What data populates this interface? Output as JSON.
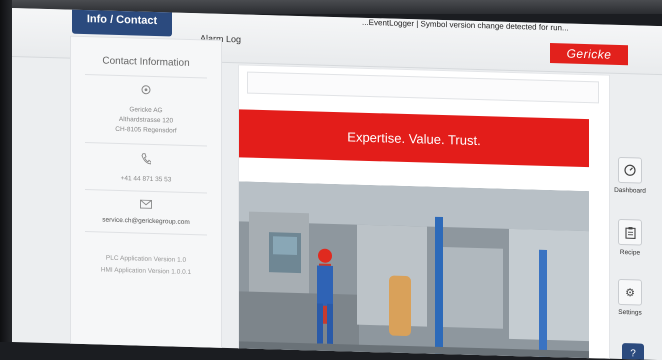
{
  "header": {
    "active_tab_label": "Info / Contact",
    "alarm_tab_label": "Alarm Log",
    "status_message": "...EventLogger | Symbol version change detected for run...",
    "logo_text": "Gericke"
  },
  "contact": {
    "title": "Contact Information",
    "location_icon": "location-pin-icon",
    "company": "Gericke AG",
    "street": "Althardstrasse 120",
    "city": "CH-8105 Regensdorf",
    "phone_icon": "phone-icon",
    "phone": "+41 44 871 35 53",
    "email_icon": "envelope-icon",
    "email": "service.ch@gerickegroup.com",
    "plc_version": "PLC Application Version 1.0",
    "hmi_version": "HMI Application Version 1.0.0.1"
  },
  "banner": {
    "text": "Expertise. Value. Trust."
  },
  "nav": {
    "dashboard": {
      "label": "Dashboard",
      "icon": "gauge-icon"
    },
    "recipe": {
      "label": "Recipe",
      "icon": "clipboard-icon"
    },
    "settings": {
      "label": "Settings",
      "icon": "gear-icon"
    },
    "help": {
      "icon": "help-icon"
    }
  },
  "colors": {
    "brand_red": "#e31d1a",
    "navy": "#2b4a7e"
  }
}
